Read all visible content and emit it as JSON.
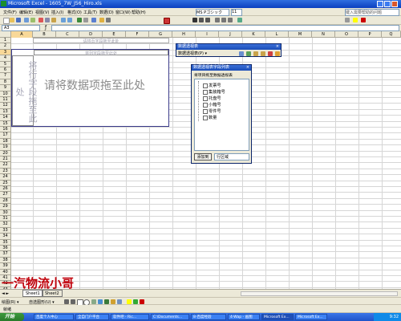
{
  "window": {
    "title": "Microsoft Excel - 1605_7W_J56_Hiro.xls"
  },
  "menu": {
    "items": [
      "文件(F)",
      "编辑(E)",
      "视图(V)",
      "插入(I)",
      "格式(O)",
      "工具(T)",
      "数据(D)",
      "窗口(W)",
      "帮助(H)"
    ],
    "font_name": "MS Pゴシック",
    "font_size": "11",
    "help_placeholder": "键入需要帮助的问题"
  },
  "formula": {
    "cell_ref": "A3"
  },
  "columns": [
    "A",
    "B",
    "C",
    "D",
    "E",
    "F",
    "G",
    "H",
    "I",
    "J",
    "K",
    "L",
    "M",
    "N",
    "O",
    "P",
    "Q"
  ],
  "rows": [
    "1",
    "2",
    "3",
    "4",
    "5",
    "6",
    "7",
    "8",
    "9",
    "10",
    "11",
    "12",
    "13",
    "14",
    "15",
    "16",
    "17",
    "18",
    "19",
    "20",
    "21",
    "22",
    "23",
    "24",
    "25",
    "26",
    "27",
    "28",
    "29",
    "30",
    "31",
    "32",
    "33",
    "34",
    "35",
    "36",
    "37",
    "38",
    "39",
    "40",
    "41",
    "42",
    "43"
  ],
  "pivot": {
    "page_drop": "请将页字段拖至此处",
    "col_drop": "将列字段拖至此处",
    "row_drop": "将行字段拖至此处",
    "data_drop": "请将数据项拖至此处"
  },
  "pivot_toolbar": {
    "title": "数据透视表",
    "menu_label": "数据透视表(P) ▾"
  },
  "field_list": {
    "title": "数据透视表字段列表",
    "hint": "将项目拖至数据透视表",
    "fields": [
      "发票号",
      "集装箱号",
      "托盘号",
      "小箱号",
      "零件号",
      "数量"
    ],
    "add_button": "添加到",
    "area_select": "行区域"
  },
  "sheet_tabs": [
    "Sheet1",
    "Sheet2"
  ],
  "watermark": "一汽物流小哥",
  "status": {
    "text": "就绪"
  },
  "drawing_toolbar": {
    "draw_label": "绘图(R) ▾",
    "autoshape_label": "自选图形(U) ▾"
  },
  "taskbar": {
    "start": "开始",
    "tasks": [
      "百度个人中心",
      "全自门户平台",
      "软件吧 - Ric...",
      "C:\\Documents...",
      "8-百度经验",
      "4-Wap - 画图",
      "Microsoft Ex...",
      "Microsoft Ex..."
    ],
    "clock": "9:32"
  },
  "colors": {
    "accent": "#0a246a",
    "watermark_red": "#c0000a"
  }
}
